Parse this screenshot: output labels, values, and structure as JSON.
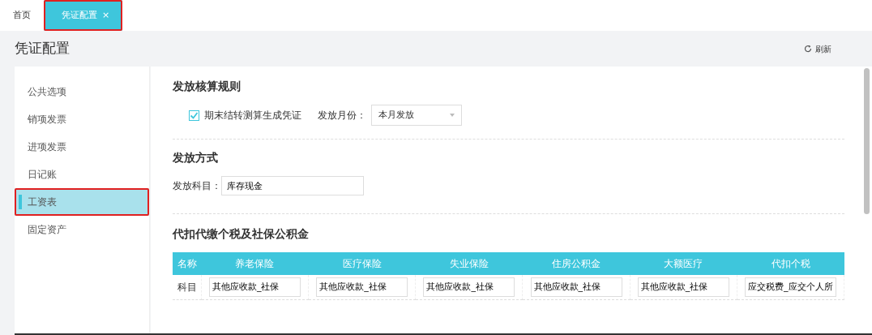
{
  "tabs": [
    {
      "label": "首页",
      "selected": false,
      "highlighted": false
    },
    {
      "label": "凭证配置",
      "selected": true,
      "close_label": "×",
      "highlighted": true
    }
  ],
  "page": {
    "title": "凭证配置",
    "refresh": "刷新"
  },
  "sidebar": {
    "items": [
      {
        "label": "公共选项",
        "selected": false,
        "highlighted": false
      },
      {
        "label": "销项发票",
        "selected": false,
        "highlighted": false
      },
      {
        "label": "进项发票",
        "selected": false,
        "highlighted": false
      },
      {
        "label": "日记账",
        "selected": false,
        "highlighted": false
      },
      {
        "label": "工资表",
        "selected": true,
        "highlighted": true
      },
      {
        "label": "固定资产",
        "selected": false,
        "highlighted": false
      }
    ]
  },
  "sections": [
    {
      "title": "发放核算规则",
      "kind": "rule",
      "checkbox": {
        "label": "期末结转测算生成凭证",
        "checked": true
      },
      "select": {
        "label": "发放月份：",
        "value": "本月发放"
      }
    },
    {
      "title": "发放方式",
      "kind": "field",
      "field": {
        "label": "发放科目：",
        "value": "库存现金"
      }
    },
    {
      "title": "代扣代缴个税及社保公积金",
      "kind": "table",
      "table": {
        "columns": [
          "名称",
          "养老保险",
          "医疗保险",
          "失业保险",
          "住房公积金",
          "大额医疗",
          "代扣个税"
        ],
        "rows": [
          {
            "label": "科目",
            "values": [
              "其他应收款_社保",
              "其他应收款_社保",
              "其他应收款_社保",
              "其他应收款_社保",
              "其他应收款_社保",
              "应交税费_应交个人所"
            ]
          }
        ]
      }
    }
  ]
}
